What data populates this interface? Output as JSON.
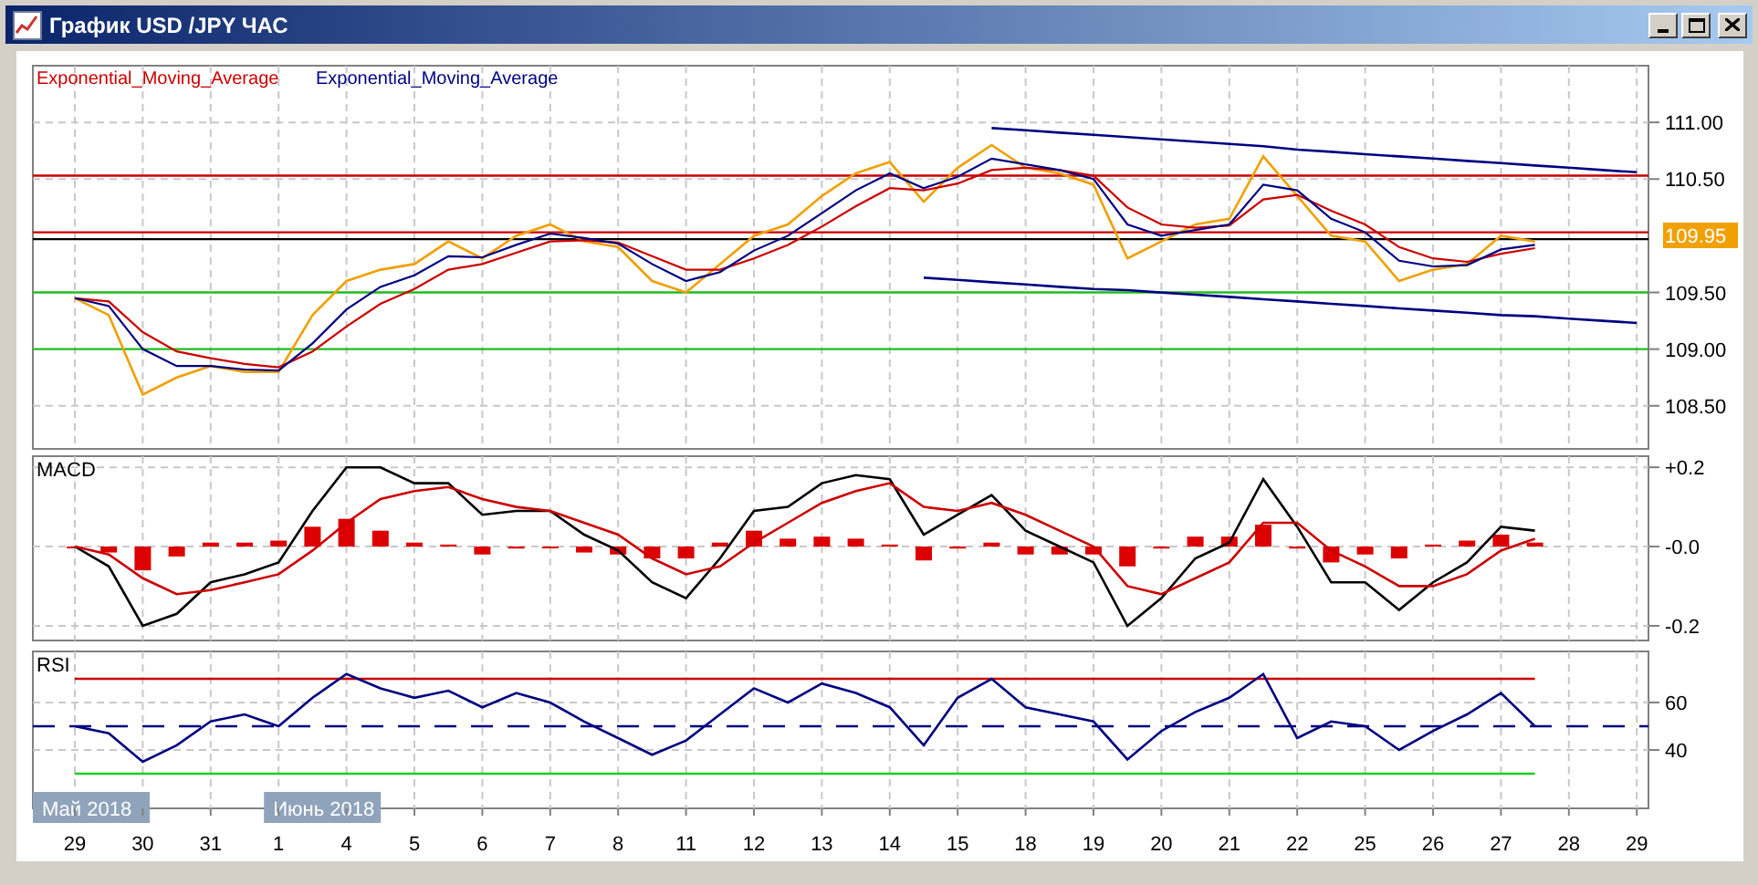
{
  "window": {
    "title": "График USD /JPY ЧАС"
  },
  "price_panel": {
    "current_price": "109.95",
    "chart_data": {
      "type": "line",
      "grid": true,
      "ylim": [
        108.12,
        111.5
      ],
      "categories": [
        null,
        null,
        null,
        null,
        null,
        null,
        null,
        null,
        null,
        null,
        null,
        null,
        null,
        null,
        null,
        null,
        null,
        null,
        null,
        null,
        null,
        null,
        null,
        null,
        null,
        null,
        null,
        null,
        null,
        null,
        null,
        null,
        null,
        null,
        null,
        null,
        null,
        null,
        null,
        null,
        null,
        null,
        null,
        null,
        null,
        null,
        null
      ],
      "yticks": [
        {
          "value": 111,
          "label": "111.00"
        },
        {
          "value": 110.5,
          "label": "110.50"
        },
        {
          "value": 109.5,
          "label": "109.50"
        },
        {
          "value": 109,
          "label": "109.00"
        },
        {
          "value": 108.5,
          "label": "108.50"
        }
      ],
      "ref_lines": [
        {
          "axis": "y",
          "value": 110.53,
          "color": "#cc0000"
        },
        {
          "axis": "y",
          "value": 110.03,
          "color": "#cc0000"
        },
        {
          "axis": "y",
          "value": 109.97,
          "color": "#000000"
        },
        {
          "axis": "y",
          "value": 109.5,
          "color": "#22bb22"
        },
        {
          "axis": "y",
          "value": 109.0,
          "color": "#22bb22"
        }
      ],
      "series": [
        {
          "color": "#f0a000",
          "values": [
            109.45,
            109.3,
            108.6,
            108.75,
            108.85,
            108.8,
            108.8,
            109.3,
            109.6,
            109.7,
            109.75,
            109.95,
            109.8,
            110.0,
            110.1,
            109.95,
            109.9,
            109.6,
            109.5,
            109.75,
            110.0,
            110.1,
            110.35,
            110.55,
            110.65,
            110.3,
            110.6,
            110.8,
            110.6,
            110.55,
            110.45,
            109.8,
            109.95,
            110.1,
            110.15,
            110.7,
            110.35,
            110.0,
            109.95,
            109.6,
            109.7,
            109.75,
            110.0,
            109.95,
            null,
            null,
            null
          ]
        },
        {
          "name": "Exponential_Moving_Average",
          "color": "#cc0000",
          "values": [
            109.45,
            109.42,
            109.15,
            108.98,
            108.92,
            108.87,
            108.84,
            108.98,
            109.2,
            109.4,
            109.53,
            109.7,
            109.75,
            109.85,
            109.95,
            109.96,
            109.94,
            109.82,
            109.7,
            109.7,
            109.8,
            109.92,
            110.08,
            110.26,
            110.42,
            110.4,
            110.46,
            110.58,
            110.6,
            110.58,
            110.53,
            110.25,
            110.1,
            110.07,
            110.09,
            110.32,
            110.36,
            110.22,
            110.1,
            109.9,
            109.8,
            109.77,
            109.84,
            109.89,
            null,
            null,
            null
          ]
        },
        {
          "name": "Exponential_Moving_Average",
          "color": "#000080",
          "values": [
            109.45,
            109.38,
            109.0,
            108.85,
            108.85,
            108.82,
            108.81,
            109.05,
            109.35,
            109.55,
            109.65,
            109.82,
            109.81,
            109.92,
            110.02,
            109.98,
            109.93,
            109.75,
            109.6,
            109.68,
            109.87,
            110.0,
            110.2,
            110.4,
            110.55,
            110.42,
            110.52,
            110.68,
            110.63,
            110.58,
            110.5,
            110.1,
            110.0,
            110.05,
            110.1,
            110.45,
            110.4,
            110.15,
            110.03,
            109.78,
            109.73,
            109.74,
            109.88,
            109.92,
            null,
            null,
            null
          ]
        },
        {
          "color": "#000080",
          "values": [
            null,
            null,
            null,
            null,
            null,
            null,
            null,
            null,
            null,
            null,
            null,
            null,
            null,
            null,
            null,
            null,
            null,
            null,
            null,
            null,
            null,
            null,
            null,
            null,
            null,
            null,
            null,
            110.95,
            110.93,
            110.91,
            110.89,
            110.87,
            110.85,
            110.83,
            110.81,
            110.79,
            110.76,
            110.74,
            110.72,
            110.7,
            110.68,
            110.66,
            110.64,
            110.62,
            110.6,
            110.58,
            110.56
          ]
        },
        {
          "color": "#000080",
          "values": [
            null,
            null,
            null,
            null,
            null,
            null,
            null,
            null,
            null,
            null,
            null,
            null,
            null,
            null,
            null,
            null,
            null,
            null,
            null,
            null,
            null,
            null,
            null,
            null,
            null,
            109.63,
            109.61,
            109.59,
            109.57,
            109.55,
            109.53,
            109.52,
            109.5,
            109.48,
            109.46,
            109.44,
            109.42,
            109.4,
            109.38,
            109.36,
            109.34,
            109.32,
            109.3,
            109.29,
            109.27,
            109.25,
            109.23
          ]
        }
      ]
    }
  },
  "macd_panel": {
    "chart_data": {
      "type": "line",
      "title": "MACD",
      "grid": true,
      "ylim": [
        -0.237,
        0.228
      ],
      "categories": [
        null,
        null,
        null,
        null,
        null,
        null,
        null,
        null,
        null,
        null,
        null,
        null,
        null,
        null,
        null,
        null,
        null,
        null,
        null,
        null,
        null,
        null,
        null,
        null,
        null,
        null,
        null,
        null,
        null,
        null,
        null,
        null,
        null,
        null,
        null,
        null,
        null,
        null,
        null,
        null,
        null,
        null,
        null,
        null
      ],
      "yticks": [
        {
          "value": 0.2,
          "label": "+0.2"
        },
        {
          "value": 0,
          "label": "-0.0"
        },
        {
          "value": -0.2,
          "label": "-0.2"
        }
      ],
      "series": [
        {
          "type": "bar",
          "color": "#dd0000",
          "values": [
            0,
            -0.015,
            -0.06,
            -0.025,
            0.01,
            0.01,
            0.015,
            0.05,
            0.07,
            0.04,
            0.01,
            0.005,
            -0.02,
            -0.005,
            0,
            -0.015,
            -0.02,
            -0.03,
            -0.03,
            0.01,
            0.04,
            0.02,
            0.025,
            0.02,
            0.005,
            -0.035,
            -0.005,
            0.01,
            -0.02,
            -0.02,
            -0.02,
            -0.05,
            -0.005,
            0.025,
            0.025,
            0.055,
            -0.005,
            -0.04,
            -0.02,
            -0.03,
            0.005,
            0.015,
            0.03,
            0.01
          ]
        },
        {
          "type": "line",
          "color": "#000000",
          "values": [
            0,
            -0.05,
            -0.2,
            -0.17,
            -0.09,
            -0.07,
            -0.04,
            0.09,
            0.2,
            0.2,
            0.16,
            0.16,
            0.08,
            0.09,
            0.09,
            0.03,
            -0.01,
            -0.09,
            -0.13,
            -0.03,
            0.09,
            0.1,
            0.16,
            0.18,
            0.17,
            0.03,
            0.08,
            0.13,
            0.04,
            0,
            -0.04,
            -0.2,
            -0.13,
            -0.03,
            0.01,
            0.17,
            0.05,
            -0.09,
            -0.09,
            -0.16,
            -0.09,
            -0.04,
            0.05,
            0.04
          ]
        },
        {
          "type": "line",
          "color": "#cc0000",
          "values": [
            0,
            -0.02,
            -0.08,
            -0.12,
            -0.11,
            -0.09,
            -0.07,
            -0.01,
            0.06,
            0.12,
            0.14,
            0.15,
            0.12,
            0.1,
            0.09,
            0.06,
            0.03,
            -0.03,
            -0.07,
            -0.05,
            0.01,
            0.06,
            0.11,
            0.14,
            0.16,
            0.1,
            0.09,
            0.11,
            0.08,
            0.04,
            0,
            -0.1,
            -0.12,
            -0.08,
            -0.04,
            0.06,
            0.06,
            -0.01,
            -0.05,
            -0.1,
            -0.1,
            -0.07,
            -0.01,
            0.02
          ]
        }
      ]
    }
  },
  "rsi_panel": {
    "period_labels": [
      "Май 2018",
      "Июнь 2018"
    ],
    "date_labels": [
      "29",
      "30",
      "31",
      "1",
      "4",
      "5",
      "6",
      "7",
      "8",
      "11",
      "12",
      "13",
      "14",
      "15",
      "18",
      "19",
      "20",
      "21",
      "22",
      "25",
      "26",
      "27",
      "28",
      "29"
    ],
    "chart_data": {
      "type": "line",
      "title": "RSI",
      "grid": true,
      "ylim": [
        15.4,
        81.5
      ],
      "categories": [
        null,
        null,
        null,
        null,
        null,
        null,
        null,
        null,
        null,
        null,
        null,
        null,
        null,
        null,
        null,
        null,
        null,
        null,
        null,
        null,
        null,
        null,
        null,
        null,
        null,
        null,
        null,
        null,
        null,
        null,
        null,
        null,
        null,
        null,
        null,
        null,
        null,
        null,
        null,
        null,
        null,
        null,
        null,
        null
      ],
      "yticks": [
        {
          "value": 60,
          "label": "60"
        },
        {
          "value": 40,
          "label": "40"
        }
      ],
      "ref_lines": [
        {
          "axis": "y",
          "value": 50,
          "color": "#000080"
        }
      ],
      "series": [
        {
          "color": "#cc0000",
          "values": [
            70,
            70,
            70,
            70,
            70,
            70,
            70,
            70,
            70,
            70,
            70,
            70,
            70,
            70,
            70,
            70,
            70,
            70,
            70,
            70,
            70,
            70,
            70,
            70,
            70,
            70,
            70,
            70,
            70,
            70,
            70,
            70,
            70,
            70,
            70,
            70,
            70,
            70,
            70,
            70,
            70,
            70,
            70,
            70
          ]
        },
        {
          "color": "#22cc22",
          "values": [
            30,
            30,
            30,
            30,
            30,
            30,
            30,
            30,
            30,
            30,
            30,
            30,
            30,
            30,
            30,
            30,
            30,
            30,
            30,
            30,
            30,
            30,
            30,
            30,
            30,
            30,
            30,
            30,
            30,
            30,
            30,
            30,
            30,
            30,
            30,
            30,
            30,
            30,
            30,
            30,
            30,
            30,
            30,
            30
          ]
        },
        {
          "color": "#000080",
          "values": [
            50,
            47,
            35,
            42,
            52,
            55,
            50,
            62,
            72,
            66,
            62,
            65,
            58,
            64,
            60,
            52,
            45,
            38,
            44,
            55,
            66,
            60,
            68,
            64,
            58,
            42,
            62,
            70,
            58,
            55,
            52,
            36,
            48,
            56,
            62,
            72,
            45,
            52,
            50,
            40,
            48,
            55,
            64,
            50
          ]
        }
      ]
    }
  }
}
